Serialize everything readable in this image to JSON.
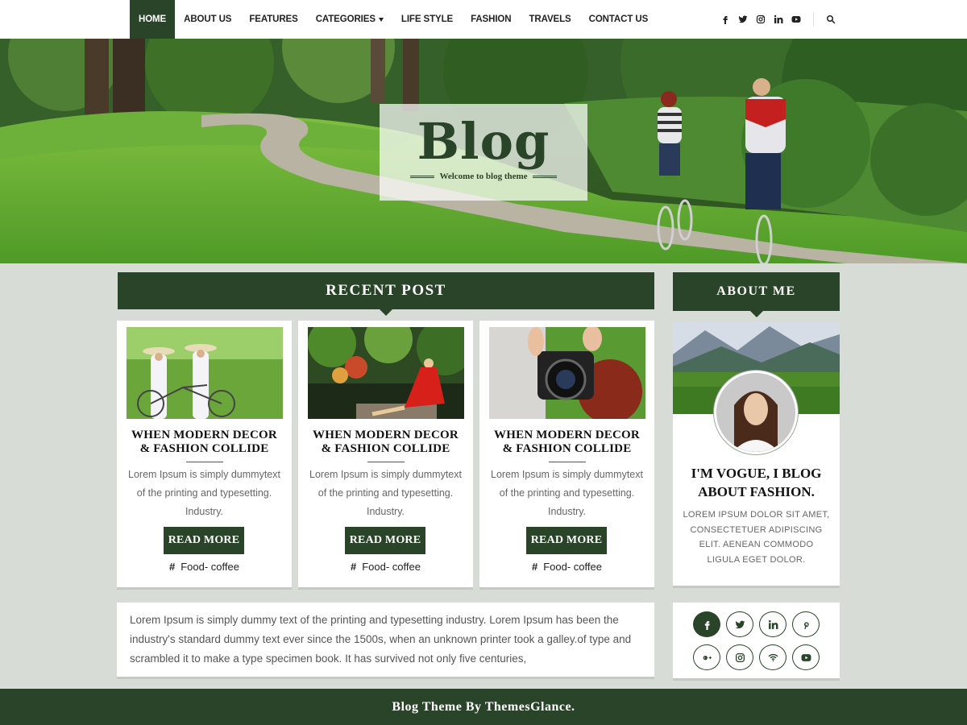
{
  "nav": {
    "items": [
      {
        "label": "HOME",
        "active": true
      },
      {
        "label": "ABOUT US"
      },
      {
        "label": "FEATURES"
      },
      {
        "label": "CATEGORIES",
        "has_dropdown": true
      },
      {
        "label": "LIFE STYLE"
      },
      {
        "label": "FASHION"
      },
      {
        "label": "TRAVELS"
      },
      {
        "label": "CONTACT US"
      }
    ],
    "social_icons": [
      "facebook-icon",
      "twitter-icon",
      "instagram-icon",
      "linkedin-icon",
      "youtube-icon"
    ],
    "search_icon": "search-icon"
  },
  "hero": {
    "logo_title": "Blog",
    "logo_tagline": "Welcome to blog theme"
  },
  "recent": {
    "heading": "RECENT POST",
    "posts": [
      {
        "title_line1": "WHEN MODERN DECOR",
        "title_line2": "& FASHION COLLIDE",
        "excerpt": "Lorem Ipsum is simply dummytext of the printing and typesetting. Industry.",
        "button": "READ MORE",
        "tag": "Food- coffee"
      },
      {
        "title_line1": "WHEN MODERN DECOR",
        "title_line2": "& FASHION COLLIDE",
        "excerpt": "Lorem Ipsum is simply dummytext of the printing and typesetting. Industry.",
        "button": "READ MORE",
        "tag": "Food- coffee"
      },
      {
        "title_line1": "WHEN MODERN DECOR",
        "title_line2": "& FASHION COLLIDE",
        "excerpt": "Lorem Ipsum is simply dummytext of the printing and typesetting. Industry.",
        "button": "READ MORE",
        "tag": "Food- coffee"
      }
    ]
  },
  "text_box": {
    "content": "Lorem Ipsum is simply dummy text of the printing and typesetting industry. Lorem Ipsum has been the industry's standard dummy text ever since the 1500s, when an unknown printer took a galley.of type and scrambled it to make a type specimen book. It has survived not only five centuries,"
  },
  "about": {
    "heading": "ABOUT ME",
    "title_line1": "I'M VOGUE, I BLOG",
    "title_line2": "ABOUT FASHION.",
    "body": "LOREM IPSUM DOLOR SIT AMET, CONSECTETUER ADIPISCING ELIT. AENEAN COMMODO LIGULA EGET DOLOR."
  },
  "social_box": {
    "icons": [
      "facebook-icon",
      "twitter-icon",
      "linkedin-icon",
      "pinterest-icon",
      "google-plus-icon",
      "instagram-icon",
      "wifi-icon",
      "youtube-icon"
    ]
  },
  "footer": {
    "text": "Blog Theme By ThemesGlance."
  },
  "colors": {
    "brand_green": "#294428",
    "page_bg": "#d7dcd7"
  }
}
